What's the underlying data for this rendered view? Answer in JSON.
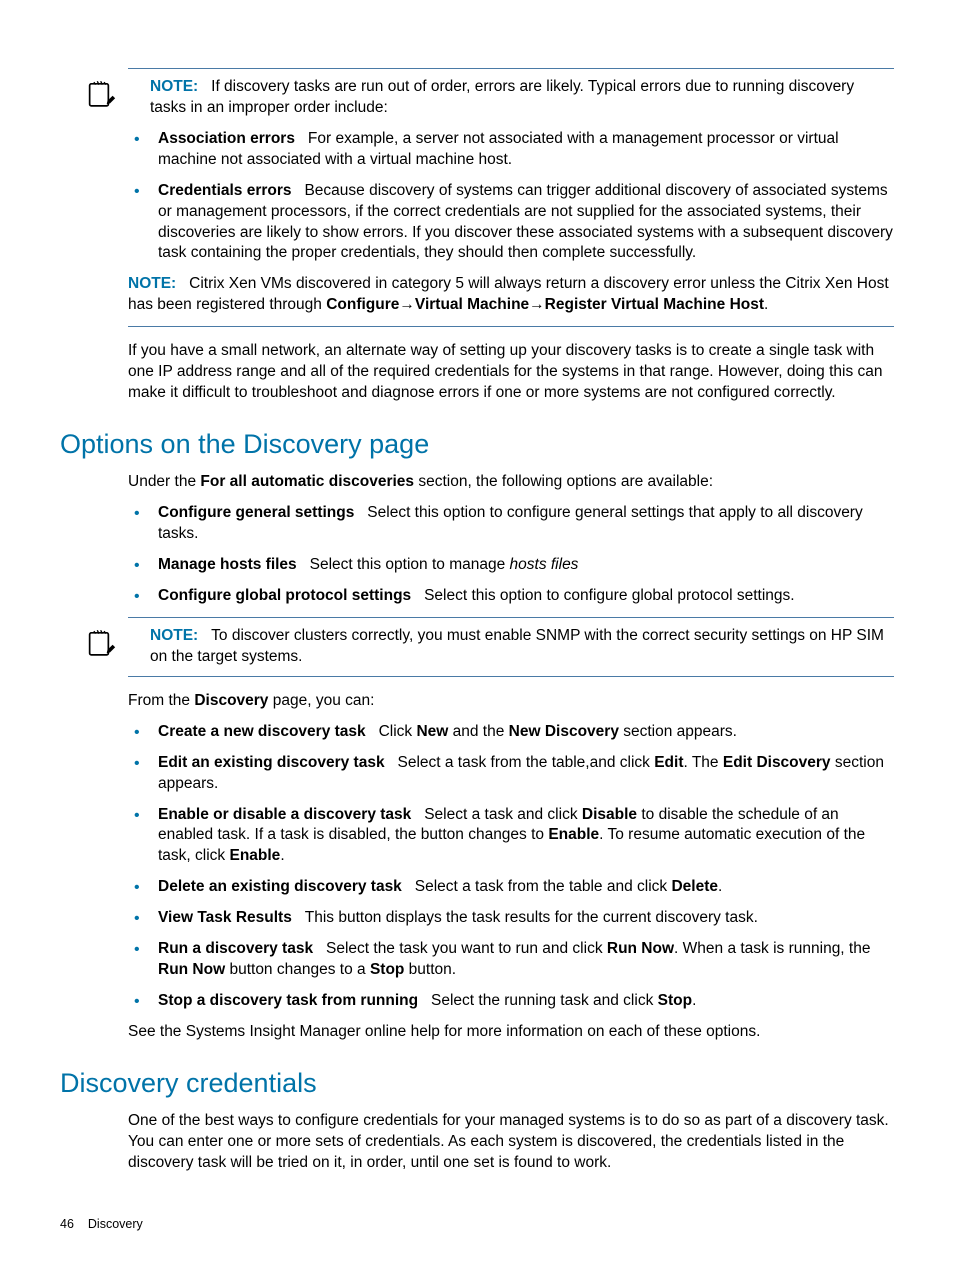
{
  "notes": {
    "label": "NOTE:",
    "top_intro": "If discovery tasks are run out of order, errors are likely. Typical errors due to running discovery tasks in an improper order include:",
    "xen_pre": "Citrix Xen VMs discovered in category 5 will always return a discovery error unless the Citrix Xen Host has been registered through ",
    "xen_path1": "Configure",
    "xen_path2": "Virtual Machine",
    "xen_path3": "Register Virtual Machine Host",
    "cluster": "To discover clusters correctly, you must enable SNMP with the correct security settings on HP SIM on the target systems."
  },
  "error_bullets": {
    "assoc_title": "Association errors",
    "assoc_body": "For example, a server not associated with a management processor or virtual machine not associated with a virtual machine host.",
    "cred_title": "Credentials errors",
    "cred_body": "Because discovery of systems can trigger additional discovery of associated systems or management processors, if the correct credentials are not supplied for the associated systems, their discoveries are likely to show errors. If you discover these associated systems with a subsequent discovery task containing the proper credentials, they should then complete successfully."
  },
  "small_net_para": "If you have a small network, an alternate way of setting up your discovery tasks is to create a single task with one IP address range and all of the required credentials for the systems in that range. However, doing this can make it difficult to troubleshoot and diagnose errors if one or more systems are not configured correctly.",
  "headings": {
    "options": "Options on the Discovery page",
    "creds": "Discovery credentials"
  },
  "options_intro_pre": "Under the ",
  "options_intro_bold": "For all automatic discoveries",
  "options_intro_post": " section, the following options are available:",
  "options_bullets": {
    "cfg_gen_title": "Configure general settings",
    "cfg_gen_body": "Select this option to configure general settings that apply to all discovery tasks.",
    "manage_hosts_title": "Manage hosts files",
    "manage_hosts_body_pre": "Select this option to manage ",
    "manage_hosts_ital": "hosts files",
    "cfg_global_title": "Configure global protocol settings",
    "cfg_global_body": "Select this option to configure global protocol settings."
  },
  "from_discovery_pre": "From the ",
  "from_discovery_bold": "Discovery",
  "from_discovery_post": " page, you can:",
  "action_bullets": {
    "create_title": "Create a new discovery task",
    "create_pre": "Click ",
    "create_b1": "New",
    "create_mid": " and the ",
    "create_b2": "New Discovery",
    "create_post": " section appears.",
    "edit_title": "Edit an existing discovery task",
    "edit_pre": "Select a task from the table,and click ",
    "edit_b1": "Edit",
    "edit_mid": ". The ",
    "edit_b2": "Edit Discovery",
    "edit_post": " section appears.",
    "enable_title": "Enable or disable a discovery task",
    "enable_pre": "Select a task and click ",
    "enable_b1": "Disable",
    "enable_mid1": " to disable the schedule of an enabled task. If a task is disabled, the button changes to ",
    "enable_b2": "Enable",
    "enable_mid2": ". To resume automatic execution of the task, click ",
    "enable_b3": "Enable",
    "enable_post": ".",
    "delete_title": "Delete an existing discovery task",
    "delete_pre": "Select a task from the table and click ",
    "delete_b1": "Delete",
    "delete_post": ".",
    "view_title": "View Task Results",
    "view_body": "This button displays the task results for the current discovery task.",
    "run_title": "Run a discovery task",
    "run_pre": "Select the task you want to run and click ",
    "run_b1": "Run Now",
    "run_mid1": ". When a task is running, the ",
    "run_b2": "Run Now",
    "run_mid2": " button changes to a ",
    "run_b3": "Stop",
    "run_post": " button.",
    "stop_title": "Stop a discovery task from running",
    "stop_pre": "Select the running task and click ",
    "stop_b1": "Stop",
    "stop_post": "."
  },
  "see_more": "See the Systems Insight Manager online help for more information on each of these options.",
  "creds_para": "One of the best ways to configure credentials for your managed systems is to do so as part of a discovery task. You can enter one or more sets of credentials. As each system is discovered, the credentials listed in the discovery task will be tried on it, in order, until one set is found to work.",
  "footer": {
    "page_num": "46",
    "chapter": "Discovery"
  }
}
